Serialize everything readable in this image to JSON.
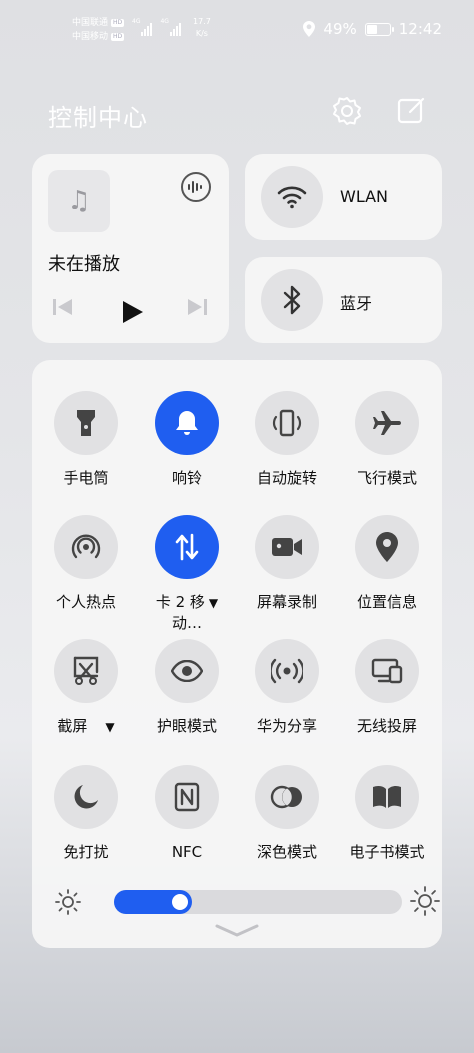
{
  "status_bar": {
    "carrier1": "中国联通",
    "carrier2": "中国移动",
    "hd": "HD",
    "net1": "4G",
    "net2": "4G",
    "speed_value": "17.7",
    "speed_unit": "K/s",
    "battery_percent": "49%",
    "battery_level": 0.49,
    "time": "12:42"
  },
  "header": {
    "title": "控制中心"
  },
  "media": {
    "status": "未在播放"
  },
  "connectivity": {
    "wlan_label": "WLAN",
    "bluetooth_label": "蓝牙"
  },
  "tiles": [
    {
      "label": "手电筒",
      "icon": "flashlight-icon",
      "active": false
    },
    {
      "label": "响铃",
      "icon": "bell-icon",
      "active": true
    },
    {
      "label": "自动旋转",
      "icon": "auto-rotate-icon",
      "active": false
    },
    {
      "label": "飞行模式",
      "icon": "airplane-icon",
      "active": false
    },
    {
      "label": "个人热点",
      "icon": "hotspot-icon",
      "active": false
    },
    {
      "label": "卡 2 移动…",
      "label_line1": "卡 2 移",
      "label_line2": "动…",
      "icon": "mobile-data-icon",
      "active": true
    },
    {
      "label": "屏幕录制",
      "icon": "screen-record-icon",
      "active": false
    },
    {
      "label": "位置信息",
      "icon": "location-icon",
      "active": false
    },
    {
      "label": "截屏",
      "icon": "screenshot-icon",
      "active": false
    },
    {
      "label": "护眼模式",
      "icon": "eye-icon",
      "active": false
    },
    {
      "label": "华为分享",
      "icon": "huawei-share-icon",
      "active": false
    },
    {
      "label": "无线投屏",
      "icon": "wireless-projection-icon",
      "active": false
    },
    {
      "label": "免打扰",
      "icon": "moon-icon",
      "active": false
    },
    {
      "label": "NFC",
      "icon": "nfc-icon",
      "active": false
    },
    {
      "label": "深色模式",
      "icon": "dark-mode-icon",
      "active": false
    },
    {
      "label": "电子书模式",
      "icon": "ebook-icon",
      "active": false
    }
  ],
  "brightness": {
    "level": 0.27
  },
  "colors": {
    "accent": "#1f5ef0",
    "tile_off": "#e1e1e3",
    "card_bg": "#f5f5f6"
  }
}
